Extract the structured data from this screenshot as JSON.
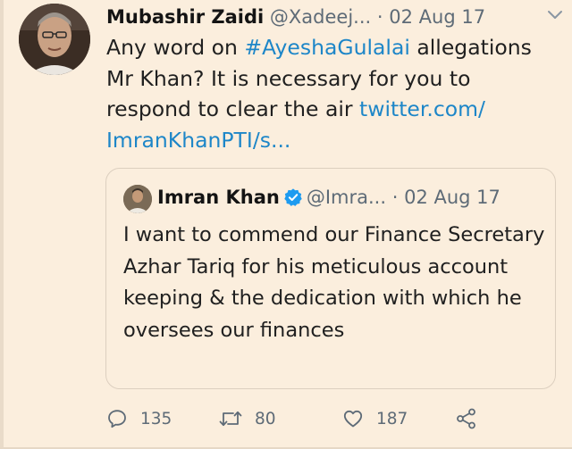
{
  "tweet": {
    "author_name": "Mubashir Zaidi",
    "author_handle": "@Xadeej...",
    "separator": "·",
    "date": "02 Aug 17",
    "text_parts": {
      "part1": "Any word on ",
      "hashtag": "#AyeshaGulalai",
      "part2": " allegations Mr Khan? It is necessary for you to respond to clear the air ",
      "link": "twitter.com/ ImranKhanPTI/s..."
    }
  },
  "quoted_tweet": {
    "author_name": "Imran Khan",
    "author_handle": "@Imra...",
    "separator": "·",
    "date": "02 Aug 17",
    "text": "I want to commend our Finance Secretary Azhar Tariq for his meticulous account keeping & the dedication with which he oversees our finances"
  },
  "actions": {
    "replies": "135",
    "retweets": "80",
    "likes": "187"
  },
  "colors": {
    "background": "#fbeedd",
    "link": "#1d86c8",
    "muted": "#5e6b77",
    "verified": "#1d9bf0"
  },
  "icons": [
    "chevron-down-icon",
    "verified-badge-icon",
    "reply-icon",
    "retweet-icon",
    "like-icon",
    "share-icon"
  ]
}
